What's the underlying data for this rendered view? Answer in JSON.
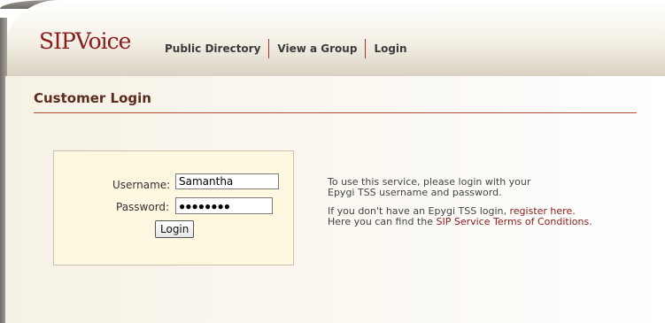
{
  "brand": {
    "logo_text": "SIPVoice",
    "accent": "#8b1c1c"
  },
  "nav": {
    "items": [
      {
        "label": "Public Directory"
      },
      {
        "label": "View a Group"
      },
      {
        "label": "Login"
      }
    ]
  },
  "page": {
    "title": "Customer Login"
  },
  "login_form": {
    "username_label": "Username:",
    "username_value": "Samantha",
    "password_label": "Password:",
    "password_value": "●●●●●●●●",
    "submit_label": "Login"
  },
  "info": {
    "line1": "To use this service, please login with your",
    "line2": "Epygi TSS username and password.",
    "line3_prefix": "If you don't have an Epygi TSS login,",
    "register_link": "register here",
    "line3_suffix": ".",
    "line4_prefix": "Here you can find the",
    "terms_link": "SIP Service Terms of Conditions",
    "line4_suffix": "."
  }
}
